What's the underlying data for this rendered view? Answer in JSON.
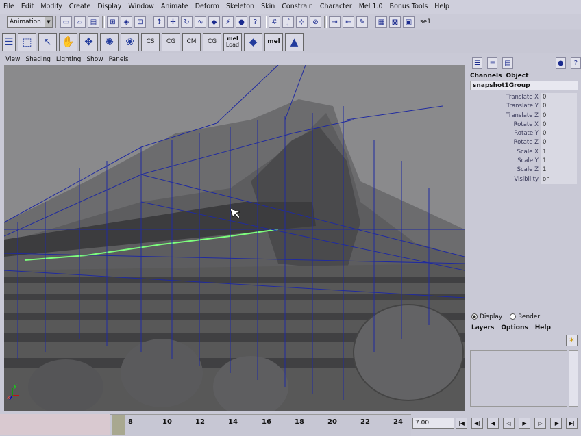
{
  "menubar": [
    "File",
    "Edit",
    "Modify",
    "Create",
    "Display",
    "Window",
    "Animate",
    "Deform",
    "Skeleton",
    "Skin",
    "Constrain",
    "Character",
    "Mel 1.0",
    "Bonus Tools",
    "Help"
  ],
  "mode_select": "Animation",
  "set_label": "se1",
  "shelf_icons": [
    "select-tool-icon",
    "lasso-tool-icon",
    "paint-tool-icon",
    "move-tool-icon",
    "rotate-tool-icon",
    "scale-tool-icon",
    "snap-icon",
    "cg-s-icon",
    "cg-m-icon",
    "mel-load-icon",
    "layer-icon",
    "mel-icon",
    "up-axis-icon"
  ],
  "shelf_text": {
    "cg1": "S",
    "cg2": "G",
    "cg3": "M",
    "cg4": "G",
    "melload_top": "mel",
    "melload_bottom": "Load",
    "mel": "mel"
  },
  "panel_menu": [
    "View",
    "Shading",
    "Lighting",
    "Show",
    "Panels"
  ],
  "channel_box": {
    "tabs": [
      "Channels",
      "Object"
    ],
    "object": "snapshot1Group",
    "attributes": [
      {
        "name": "Translate X",
        "value": "0"
      },
      {
        "name": "Translate Y",
        "value": "0"
      },
      {
        "name": "Translate Z",
        "value": "0"
      },
      {
        "name": "Rotate X",
        "value": "0"
      },
      {
        "name": "Rotate Y",
        "value": "0"
      },
      {
        "name": "Rotate Z",
        "value": "0"
      },
      {
        "name": "Scale X",
        "value": "1"
      },
      {
        "name": "Scale Y",
        "value": "1"
      },
      {
        "name": "Scale Z",
        "value": "1"
      },
      {
        "name": "Visibility",
        "value": "on"
      }
    ]
  },
  "layer_editor": {
    "display": "Display",
    "render": "Render",
    "menu": [
      "Layers",
      "Options",
      "Help"
    ]
  },
  "timeline": {
    "ticks": [
      "8",
      "10",
      "12",
      "14",
      "16",
      "18",
      "20",
      "22",
      "24"
    ],
    "current_frame": "7.00"
  },
  "viewport": {
    "axis_x": "x",
    "axis_y": "y"
  }
}
